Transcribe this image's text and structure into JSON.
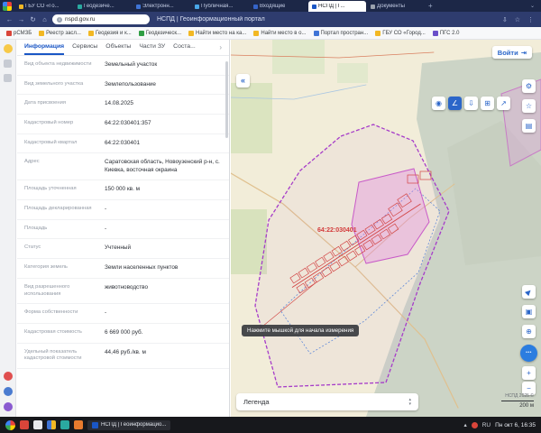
{
  "colors": {
    "accent_blue": "#2b66c9",
    "chrome_dark": "#1c2747",
    "chrome_mid": "#2e3c6e",
    "boundary_purple": "#a63cc9",
    "parcel_red": "#d24545",
    "map_background": "#f2edd9"
  },
  "browser": {
    "tabs": [
      {
        "label": "ГБУ СО «Го...",
        "active": false
      },
      {
        "label": "Геодезиче...",
        "active": false
      },
      {
        "label": "Электронн...",
        "active": false
      },
      {
        "label": "Публичная...",
        "active": false
      },
      {
        "label": "Входящие",
        "active": false
      },
      {
        "label": "НСПД | Г...",
        "active": true
      },
      {
        "label": "Документы",
        "active": false
      }
    ],
    "new_tab_icon": "+",
    "tab_overflow_icon": "⌄",
    "nav": {
      "back_icon": "←",
      "forward_icon": "→",
      "reload_icon": "↻",
      "home_icon": "⌂"
    },
    "address": {
      "site_icon": "i",
      "url": "nspd.gov.ru",
      "page_title": "НСПД | Геоинформационный портал",
      "download_icon": "⇩",
      "favorite_icon": "☆",
      "menu_icon": "⋮"
    },
    "bookmarks": [
      {
        "label": "рСМЗБ"
      },
      {
        "label": "Реестр засл..."
      },
      {
        "label": "Геодезия и к..."
      },
      {
        "label": "Геодезическ..."
      },
      {
        "label": "Найти место на ка..."
      },
      {
        "label": "Найти место в о..."
      },
      {
        "label": "Портал простран..."
      },
      {
        "label": "ГБУ СО «Город..."
      },
      {
        "label": "ПГС 2.0"
      }
    ]
  },
  "panel": {
    "tabs": [
      {
        "label": "Информация",
        "active": true
      },
      {
        "label": "Сервисы",
        "active": false
      },
      {
        "label": "Объекты",
        "active": false
      },
      {
        "label": "Части ЗУ",
        "active": false
      },
      {
        "label": "Соста...",
        "active": false
      }
    ],
    "more_icon": "›",
    "fields": [
      {
        "label": "Вид объекта недвижимости",
        "value": "Земельный участок"
      },
      {
        "label": "Вид земельного участка",
        "value": "Землепользование"
      },
      {
        "label": "Дата присвоения",
        "value": "14.08.2025"
      },
      {
        "label": "Кадастровый номер",
        "value": "64:22:030401:357"
      },
      {
        "label": "Кадастровый квартал",
        "value": "64:22:030401"
      },
      {
        "label": "Адрес",
        "value": "Саратовская область, Новоузенский р-н, с. Киевка, восточная окраина"
      },
      {
        "label": "Площадь уточненная",
        "value": "150 000 кв. м"
      },
      {
        "label": "Площадь декларированная",
        "value": "-"
      },
      {
        "label": "Площадь",
        "value": "-"
      },
      {
        "label": "Статус",
        "value": "Учтенный"
      },
      {
        "label": "Категория земель",
        "value": "Земли населенных пунктов"
      },
      {
        "label": "Вид разрешенного использования",
        "value": "животноводство"
      },
      {
        "label": "Форма собственности",
        "value": "-"
      },
      {
        "label": "Кадастровая стоимость",
        "value": "6 669 000 руб."
      },
      {
        "label": "Удельный показатель кадастровой стоимости",
        "value": "44,46 руб./кв. м"
      }
    ]
  },
  "map": {
    "collapse_icon": "«",
    "login_label": "Войти",
    "login_icon": "⇥",
    "toolbar": {
      "point_icon": "◉",
      "measure_icon": "∠",
      "download_icon": "⇩",
      "print_icon": "⊞",
      "share_icon": "↗"
    },
    "controls": {
      "settings_icon": "⚙",
      "favorites_icon": "☆",
      "layers_icon": "▤",
      "locate_icon": "▶",
      "frame_icon": "▣",
      "globe_icon": "⊕",
      "chat_icon": "•••",
      "zoom_in_icon": "+",
      "zoom_out_icon": "−"
    },
    "parcel_label": "64:22:030401",
    "tooltip": "Нажмите мышкой для начала измерения",
    "legend": {
      "label": "Легенда",
      "up_icon": "▴",
      "down_icon": "▾"
    },
    "copyright": "НСПД 2025 ©",
    "scale_label": "200 м"
  },
  "taskbar": {
    "task_label": "НСПД | Геоинформацио...",
    "tray_up_icon": "▴",
    "lang": "RU",
    "clock": "Пн окт 6, 16:35"
  }
}
